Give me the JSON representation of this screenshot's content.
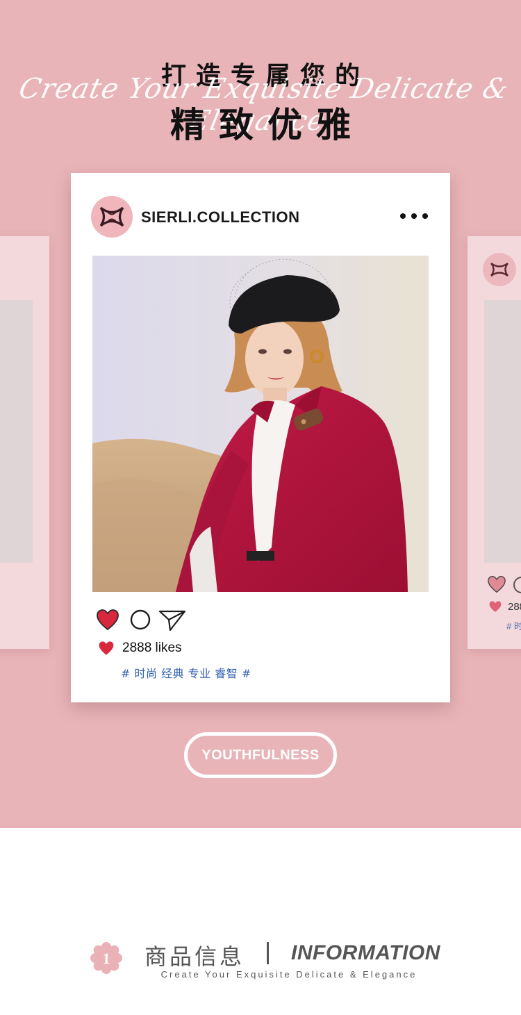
{
  "header": {
    "title_top": "打造专属您的",
    "script_text": "Create Your Exquisite Delicate & Elegance",
    "title_main": "精致优雅"
  },
  "post": {
    "username": "SIERLI.COLLECTION",
    "likes_text": "2888 likes",
    "hashtags": "# 时尚 经典 专业 睿智 #"
  },
  "side_card_right": {
    "likes_text": "288",
    "hashtag_fragment": "# 时"
  },
  "pill_button": {
    "label": "YOUTHFULNESS"
  },
  "info": {
    "number": "1",
    "title_cn": "商品信息",
    "title_en": "INFORMATION",
    "subtitle": "Create Your Exquisite Delicate & Elegance"
  },
  "icons": {
    "like": "heart-icon",
    "comment": "circle-comment-icon",
    "share": "paper-plane-icon",
    "more": "more-dots-icon",
    "brand": "brand-logo-icon"
  },
  "colors": {
    "background_pink": "#e8b4b8",
    "card_white": "#ffffff",
    "heart_red": "#d8283e",
    "hashtag_blue": "#2f5fb0",
    "coat_red": "#b0123a"
  }
}
